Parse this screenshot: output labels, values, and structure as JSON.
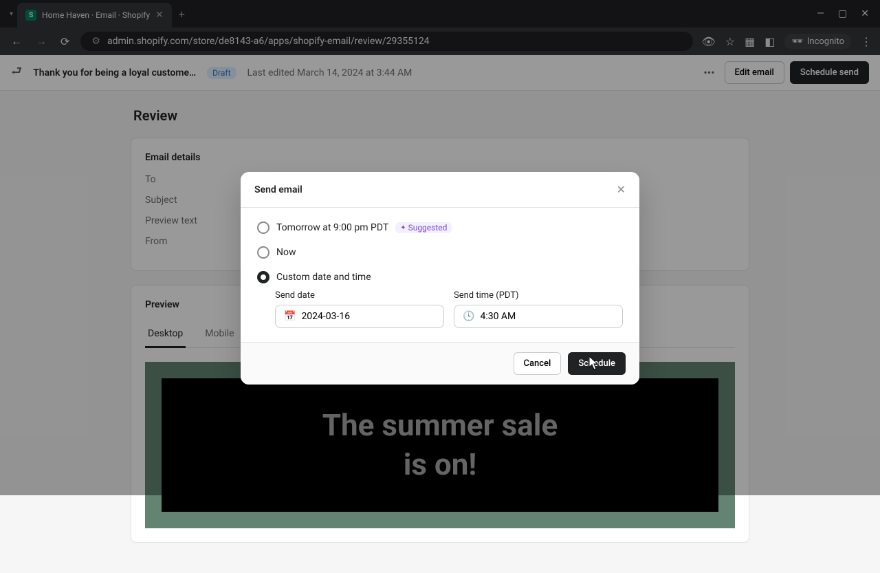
{
  "browser": {
    "tab_title": "Home Haven · Email · Shopify",
    "url": "admin.shopify.com/store/de8143-a6/apps/shopify-email/review/29355124",
    "incognito": "Incognito"
  },
  "header": {
    "title": "Thank you for being a loyal custome…",
    "status": "Draft",
    "last_edited": "Last edited March 14, 2024 at 3:44 AM",
    "edit_btn": "Edit email",
    "schedule_btn": "Schedule send"
  },
  "page": {
    "title": "Review",
    "details_title": "Email details",
    "labels": {
      "to": "To",
      "subject": "Subject",
      "preview": "Preview text",
      "from": "From"
    },
    "preview_title": "Preview",
    "tabs": {
      "desktop": "Desktop",
      "mobile": "Mobile"
    },
    "banner_line1": "The summer sale",
    "banner_line2": "is on!"
  },
  "modal": {
    "title": "Send email",
    "option_tomorrow": "Tomorrow at 9:00 pm PDT",
    "suggested": "Suggested",
    "option_now": "Now",
    "option_custom": "Custom date and time",
    "send_date_label": "Send date",
    "send_date_value": "2024-03-16",
    "send_time_label": "Send time (PDT)",
    "send_time_value": "4:30 AM",
    "cancel": "Cancel",
    "schedule": "Schedule"
  }
}
